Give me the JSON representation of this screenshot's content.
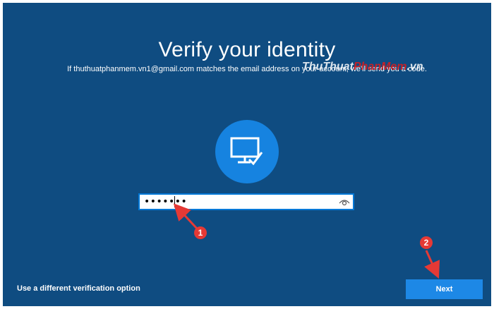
{
  "page": {
    "title": "Verify your identity",
    "subtitle": "If thuthuatphanmem.vn1@gmail.com matches the email address on your account, we'll send you a code."
  },
  "watermark": {
    "part1": "ThuThuat",
    "part2": "PhanMem",
    "part3": ".vn"
  },
  "verify_icon": "computer-check-icon",
  "code_field": {
    "value": "•••••••",
    "reveal_icon": "eye-icon"
  },
  "annotations": [
    {
      "label": "1"
    },
    {
      "label": "2"
    }
  ],
  "footer": {
    "alt_option": "Use a different verification option",
    "next_label": "Next"
  },
  "colors": {
    "background": "#0f4c81",
    "accent": "#1683e0",
    "button": "#1d88e6",
    "annotation": "#e53935"
  }
}
